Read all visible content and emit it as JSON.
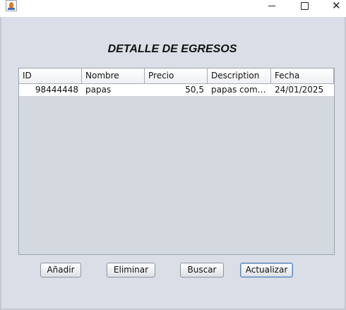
{
  "window": {
    "icons": {
      "app": "java-coffee-cup-icon",
      "minimize": "minimize-icon",
      "maximize": "maximize-icon",
      "close": "close-icon"
    },
    "minimize_glyph": "",
    "close_glyph": "✕"
  },
  "heading": "DETALLE DE EGRESOS",
  "table": {
    "columns": [
      "ID",
      "Nombre",
      "Precio",
      "Description",
      "Fecha"
    ],
    "rows": [
      {
        "id": "98444448",
        "nombre": "papas",
        "precio": "50,5",
        "description": "papas comp...",
        "fecha": "24/01/2025"
      }
    ]
  },
  "buttons": {
    "add": "Añadir",
    "delete": "Eliminar",
    "search": "Buscar",
    "update": "Actualizar"
  },
  "colors": {
    "content_bg": "#dadee6",
    "focused_button_border": "#5a7fae"
  }
}
